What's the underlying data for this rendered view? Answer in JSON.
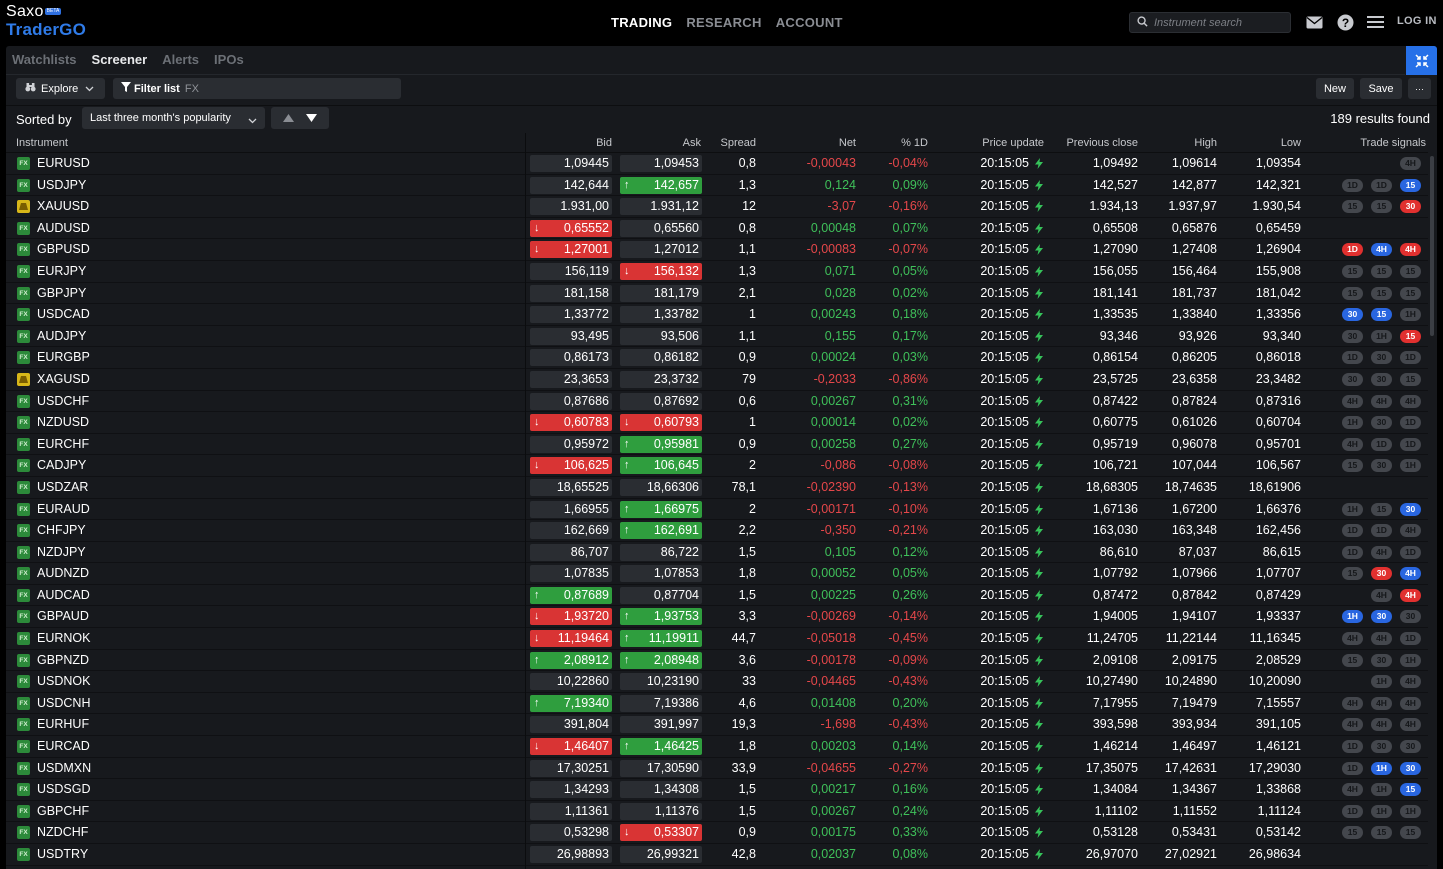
{
  "brand": {
    "name": "Saxo",
    "badge": "BETA",
    "product": "TraderGO"
  },
  "nav": {
    "items": [
      "TRADING",
      "RESEARCH",
      "ACCOUNT"
    ],
    "active": 0
  },
  "search": {
    "placeholder": "Instrument search"
  },
  "header": {
    "login": "LOG IN"
  },
  "subtabs": {
    "items": [
      "Watchlists",
      "Screener",
      "Alerts",
      "IPOs"
    ],
    "active": 1
  },
  "toolbar": {
    "explore": "Explore",
    "filter_label": "Filter list",
    "filter_value": "FX",
    "new": "New",
    "save": "Save",
    "more": "···"
  },
  "sort": {
    "label": "Sorted by",
    "value": "Last three month's popularity",
    "results": "189 results found"
  },
  "columns": {
    "instrument": "Instrument",
    "bid": "Bid",
    "ask": "Ask",
    "spread": "Spread",
    "net": "Net",
    "pct": "% 1D",
    "update": "Price update",
    "prev": "Previous close",
    "high": "High",
    "low": "Low",
    "signals": "Trade signals"
  },
  "colors": {
    "accent": "#2670e8",
    "up": "#2f9e3e",
    "down": "#d93434",
    "pos_text": "#3fc05a",
    "neg_text": "#e5474a"
  },
  "rows": [
    {
      "sym": "EURUSD",
      "icon": "fx",
      "bid": "1,09445",
      "bid_dir": "",
      "ask": "1,09453",
      "ask_dir": "",
      "spread": "0,8",
      "net": "-0,00043",
      "pct": "-0,04%",
      "time": "20:15:05",
      "prev": "1,09492",
      "high": "1,09614",
      "low": "1,09354",
      "signals": [
        [
          "4H",
          "g"
        ]
      ]
    },
    {
      "sym": "USDJPY",
      "icon": "fx",
      "bid": "142,644",
      "bid_dir": "",
      "ask": "142,657",
      "ask_dir": "up",
      "spread": "1,3",
      "net": "0,124",
      "pct": "0,09%",
      "time": "20:15:05",
      "prev": "142,527",
      "high": "142,877",
      "low": "142,321",
      "signals": [
        [
          "1D",
          "g"
        ],
        [
          "1D",
          "g"
        ],
        [
          "15",
          "b"
        ]
      ]
    },
    {
      "sym": "XAUUSD",
      "icon": "metal",
      "bid": "1.931,00",
      "bid_dir": "",
      "ask": "1.931,12",
      "ask_dir": "",
      "spread": "12",
      "net": "-3,07",
      "pct": "-0,16%",
      "time": "20:15:05",
      "prev": "1.934,13",
      "high": "1.937,97",
      "low": "1.930,54",
      "signals": [
        [
          "15",
          "g"
        ],
        [
          "15",
          "g"
        ],
        [
          "30",
          "r"
        ]
      ]
    },
    {
      "sym": "AUDUSD",
      "icon": "fx",
      "bid": "0,65552",
      "bid_dir": "down",
      "ask": "0,65560",
      "ask_dir": "",
      "spread": "0,8",
      "net": "0,00048",
      "pct": "0,07%",
      "time": "20:15:05",
      "prev": "0,65508",
      "high": "0,65876",
      "low": "0,65459",
      "signals": []
    },
    {
      "sym": "GBPUSD",
      "icon": "fx",
      "bid": "1,27001",
      "bid_dir": "down",
      "ask": "1,27012",
      "ask_dir": "",
      "spread": "1,1",
      "net": "-0,00083",
      "pct": "-0,07%",
      "time": "20:15:05",
      "prev": "1,27090",
      "high": "1,27408",
      "low": "1,26904",
      "signals": [
        [
          "1D",
          "r"
        ],
        [
          "4H",
          "b"
        ],
        [
          "4H",
          "r"
        ]
      ]
    },
    {
      "sym": "EURJPY",
      "icon": "fx",
      "bid": "156,119",
      "bid_dir": "",
      "ask": "156,132",
      "ask_dir": "down",
      "spread": "1,3",
      "net": "0,071",
      "pct": "0,05%",
      "time": "20:15:05",
      "prev": "156,055",
      "high": "156,464",
      "low": "155,908",
      "signals": [
        [
          "15",
          "g"
        ],
        [
          "15",
          "g"
        ],
        [
          "15",
          "g"
        ]
      ]
    },
    {
      "sym": "GBPJPY",
      "icon": "fx",
      "bid": "181,158",
      "bid_dir": "",
      "ask": "181,179",
      "ask_dir": "",
      "spread": "2,1",
      "net": "0,028",
      "pct": "0,02%",
      "time": "20:15:05",
      "prev": "181,141",
      "high": "181,737",
      "low": "181,042",
      "signals": [
        [
          "15",
          "g"
        ],
        [
          "15",
          "g"
        ],
        [
          "15",
          "g"
        ]
      ]
    },
    {
      "sym": "USDCAD",
      "icon": "fx",
      "bid": "1,33772",
      "bid_dir": "",
      "ask": "1,33782",
      "ask_dir": "",
      "spread": "1",
      "net": "0,00243",
      "pct": "0,18%",
      "time": "20:15:05",
      "prev": "1,33535",
      "high": "1,33840",
      "low": "1,33356",
      "signals": [
        [
          "30",
          "b"
        ],
        [
          "15",
          "b"
        ],
        [
          "1H",
          "g"
        ]
      ]
    },
    {
      "sym": "AUDJPY",
      "icon": "fx",
      "bid": "93,495",
      "bid_dir": "",
      "ask": "93,506",
      "ask_dir": "",
      "spread": "1,1",
      "net": "0,155",
      "pct": "0,17%",
      "time": "20:15:05",
      "prev": "93,346",
      "high": "93,926",
      "low": "93,340",
      "signals": [
        [
          "30",
          "g"
        ],
        [
          "1H",
          "g"
        ],
        [
          "15",
          "r"
        ]
      ]
    },
    {
      "sym": "EURGBP",
      "icon": "fx",
      "bid": "0,86173",
      "bid_dir": "",
      "ask": "0,86182",
      "ask_dir": "",
      "spread": "0,9",
      "net": "0,00024",
      "pct": "0,03%",
      "time": "20:15:05",
      "prev": "0,86154",
      "high": "0,86205",
      "low": "0,86018",
      "signals": [
        [
          "1D",
          "g"
        ],
        [
          "30",
          "g"
        ],
        [
          "1D",
          "g"
        ]
      ]
    },
    {
      "sym": "XAGUSD",
      "icon": "metal",
      "bid": "23,3653",
      "bid_dir": "",
      "ask": "23,3732",
      "ask_dir": "",
      "spread": "79",
      "net": "-0,2033",
      "pct": "-0,86%",
      "time": "20:15:05",
      "prev": "23,5725",
      "high": "23,6358",
      "low": "23,3482",
      "signals": [
        [
          "30",
          "g"
        ],
        [
          "30",
          "g"
        ],
        [
          "15",
          "g"
        ]
      ]
    },
    {
      "sym": "USDCHF",
      "icon": "fx",
      "bid": "0,87686",
      "bid_dir": "",
      "ask": "0,87692",
      "ask_dir": "",
      "spread": "0,6",
      "net": "0,00267",
      "pct": "0,31%",
      "time": "20:15:05",
      "prev": "0,87422",
      "high": "0,87824",
      "low": "0,87316",
      "signals": [
        [
          "4H",
          "g"
        ],
        [
          "4H",
          "g"
        ],
        [
          "4H",
          "g"
        ]
      ]
    },
    {
      "sym": "NZDUSD",
      "icon": "fx",
      "bid": "0,60783",
      "bid_dir": "down",
      "ask": "0,60793",
      "ask_dir": "down",
      "spread": "1",
      "net": "0,00014",
      "pct": "0,02%",
      "time": "20:15:05",
      "prev": "0,60775",
      "high": "0,61026",
      "low": "0,60704",
      "signals": [
        [
          "1H",
          "g"
        ],
        [
          "30",
          "g"
        ],
        [
          "1D",
          "g"
        ]
      ]
    },
    {
      "sym": "EURCHF",
      "icon": "fx",
      "bid": "0,95972",
      "bid_dir": "",
      "ask": "0,95981",
      "ask_dir": "up",
      "spread": "0,9",
      "net": "0,00258",
      "pct": "0,27%",
      "time": "20:15:05",
      "prev": "0,95719",
      "high": "0,96078",
      "low": "0,95701",
      "signals": [
        [
          "4H",
          "g"
        ],
        [
          "1D",
          "g"
        ],
        [
          "1D",
          "g"
        ]
      ]
    },
    {
      "sym": "CADJPY",
      "icon": "fx",
      "bid": "106,625",
      "bid_dir": "down",
      "ask": "106,645",
      "ask_dir": "up",
      "spread": "2",
      "net": "-0,086",
      "pct": "-0,08%",
      "time": "20:15:05",
      "prev": "106,721",
      "high": "107,044",
      "low": "106,567",
      "signals": [
        [
          "15",
          "g"
        ],
        [
          "30",
          "g"
        ],
        [
          "1H",
          "g"
        ]
      ]
    },
    {
      "sym": "USDZAR",
      "icon": "fx",
      "bid": "18,65525",
      "bid_dir": "",
      "ask": "18,66306",
      "ask_dir": "",
      "spread": "78,1",
      "net": "-0,02390",
      "pct": "-0,13%",
      "time": "20:15:05",
      "prev": "18,68305",
      "high": "18,74635",
      "low": "18,61906",
      "signals": []
    },
    {
      "sym": "EURAUD",
      "icon": "fx",
      "bid": "1,66955",
      "bid_dir": "",
      "ask": "1,66975",
      "ask_dir": "up",
      "spread": "2",
      "net": "-0,00171",
      "pct": "-0,10%",
      "time": "20:15:05",
      "prev": "1,67136",
      "high": "1,67200",
      "low": "1,66376",
      "signals": [
        [
          "1H",
          "g"
        ],
        [
          "15",
          "g"
        ],
        [
          "30",
          "b"
        ]
      ]
    },
    {
      "sym": "CHFJPY",
      "icon": "fx",
      "bid": "162,669",
      "bid_dir": "",
      "ask": "162,691",
      "ask_dir": "up",
      "spread": "2,2",
      "net": "-0,350",
      "pct": "-0,21%",
      "time": "20:15:05",
      "prev": "163,030",
      "high": "163,348",
      "low": "162,456",
      "signals": [
        [
          "1D",
          "g"
        ],
        [
          "1D",
          "g"
        ],
        [
          "4H",
          "g"
        ]
      ]
    },
    {
      "sym": "NZDJPY",
      "icon": "fx",
      "bid": "86,707",
      "bid_dir": "",
      "ask": "86,722",
      "ask_dir": "",
      "spread": "1,5",
      "net": "0,105",
      "pct": "0,12%",
      "time": "20:15:05",
      "prev": "86,610",
      "high": "87,037",
      "low": "86,615",
      "signals": [
        [
          "1D",
          "g"
        ],
        [
          "4H",
          "g"
        ],
        [
          "1D",
          "g"
        ]
      ]
    },
    {
      "sym": "AUDNZD",
      "icon": "fx",
      "bid": "1,07835",
      "bid_dir": "",
      "ask": "1,07853",
      "ask_dir": "",
      "spread": "1,8",
      "net": "0,00052",
      "pct": "0,05%",
      "time": "20:15:05",
      "prev": "1,07792",
      "high": "1,07966",
      "low": "1,07707",
      "signals": [
        [
          "15",
          "g"
        ],
        [
          "30",
          "r"
        ],
        [
          "4H",
          "b"
        ]
      ]
    },
    {
      "sym": "AUDCAD",
      "icon": "fx",
      "bid": "0,87689",
      "bid_dir": "up",
      "ask": "0,87704",
      "ask_dir": "",
      "spread": "1,5",
      "net": "0,00225",
      "pct": "0,26%",
      "time": "20:15:05",
      "prev": "0,87472",
      "high": "0,87842",
      "low": "0,87429",
      "signals": [
        [
          "4H",
          "g"
        ],
        [
          "4H",
          "r"
        ]
      ]
    },
    {
      "sym": "GBPAUD",
      "icon": "fx",
      "bid": "1,93720",
      "bid_dir": "down",
      "ask": "1,93753",
      "ask_dir": "up",
      "spread": "3,3",
      "net": "-0,00269",
      "pct": "-0,14%",
      "time": "20:15:05",
      "prev": "1,94005",
      "high": "1,94107",
      "low": "1,93337",
      "signals": [
        [
          "1H",
          "b"
        ],
        [
          "30",
          "b"
        ],
        [
          "30",
          "g"
        ]
      ]
    },
    {
      "sym": "EURNOK",
      "icon": "fx",
      "bid": "11,19464",
      "bid_dir": "down",
      "ask": "11,19911",
      "ask_dir": "up",
      "spread": "44,7",
      "net": "-0,05018",
      "pct": "-0,45%",
      "time": "20:15:05",
      "prev": "11,24705",
      "high": "11,22144",
      "low": "11,16345",
      "signals": [
        [
          "4H",
          "g"
        ],
        [
          "4H",
          "g"
        ],
        [
          "1D",
          "g"
        ]
      ]
    },
    {
      "sym": "GBPNZD",
      "icon": "fx",
      "bid": "2,08912",
      "bid_dir": "up",
      "ask": "2,08948",
      "ask_dir": "up",
      "spread": "3,6",
      "net": "-0,00178",
      "pct": "-0,09%",
      "time": "20:15:05",
      "prev": "2,09108",
      "high": "2,09175",
      "low": "2,08529",
      "signals": [
        [
          "15",
          "g"
        ],
        [
          "30",
          "g"
        ],
        [
          "1H",
          "g"
        ]
      ]
    },
    {
      "sym": "USDNOK",
      "icon": "fx",
      "bid": "10,22860",
      "bid_dir": "",
      "ask": "10,23190",
      "ask_dir": "",
      "spread": "33",
      "net": "-0,04465",
      "pct": "-0,43%",
      "time": "20:15:05",
      "prev": "10,27490",
      "high": "10,24890",
      "low": "10,20090",
      "signals": [
        [
          "1H",
          "g"
        ],
        [
          "4H",
          "g"
        ]
      ]
    },
    {
      "sym": "USDCNH",
      "icon": "fx",
      "bid": "7,19340",
      "bid_dir": "up",
      "ask": "7,19386",
      "ask_dir": "",
      "spread": "4,6",
      "net": "0,01408",
      "pct": "0,20%",
      "time": "20:15:05",
      "prev": "7,17955",
      "high": "7,19479",
      "low": "7,15557",
      "signals": [
        [
          "4H",
          "g"
        ],
        [
          "4H",
          "g"
        ],
        [
          "4H",
          "g"
        ]
      ]
    },
    {
      "sym": "EURHUF",
      "icon": "fx",
      "bid": "391,804",
      "bid_dir": "",
      "ask": "391,997",
      "ask_dir": "",
      "spread": "19,3",
      "net": "-1,698",
      "pct": "-0,43%",
      "time": "20:15:05",
      "prev": "393,598",
      "high": "393,934",
      "low": "391,105",
      "signals": [
        [
          "4H",
          "g"
        ],
        [
          "4H",
          "g"
        ],
        [
          "4H",
          "g"
        ]
      ]
    },
    {
      "sym": "EURCAD",
      "icon": "fx",
      "bid": "1,46407",
      "bid_dir": "down",
      "ask": "1,46425",
      "ask_dir": "up",
      "spread": "1,8",
      "net": "0,00203",
      "pct": "0,14%",
      "time": "20:15:05",
      "prev": "1,46214",
      "high": "1,46497",
      "low": "1,46121",
      "signals": [
        [
          "1D",
          "g"
        ],
        [
          "30",
          "g"
        ],
        [
          "30",
          "g"
        ]
      ]
    },
    {
      "sym": "USDMXN",
      "icon": "fx",
      "bid": "17,30251",
      "bid_dir": "",
      "ask": "17,30590",
      "ask_dir": "",
      "spread": "33,9",
      "net": "-0,04655",
      "pct": "-0,27%",
      "time": "20:15:05",
      "prev": "17,35075",
      "high": "17,42631",
      "low": "17,29030",
      "signals": [
        [
          "1D",
          "g"
        ],
        [
          "1H",
          "b"
        ],
        [
          "30",
          "b"
        ]
      ]
    },
    {
      "sym": "USDSGD",
      "icon": "fx",
      "bid": "1,34293",
      "bid_dir": "",
      "ask": "1,34308",
      "ask_dir": "",
      "spread": "1,5",
      "net": "0,00217",
      "pct": "0,16%",
      "time": "20:15:05",
      "prev": "1,34084",
      "high": "1,34367",
      "low": "1,33868",
      "signals": [
        [
          "4H",
          "g"
        ],
        [
          "1H",
          "g"
        ],
        [
          "15",
          "b"
        ]
      ]
    },
    {
      "sym": "GBPCHF",
      "icon": "fx",
      "bid": "1,11361",
      "bid_dir": "",
      "ask": "1,11376",
      "ask_dir": "",
      "spread": "1,5",
      "net": "0,00267",
      "pct": "0,24%",
      "time": "20:15:05",
      "prev": "1,11102",
      "high": "1,11552",
      "low": "1,11124",
      "signals": [
        [
          "1D",
          "g"
        ],
        [
          "1H",
          "g"
        ],
        [
          "1H",
          "g"
        ]
      ]
    },
    {
      "sym": "NZDCHF",
      "icon": "fx",
      "bid": "0,53298",
      "bid_dir": "",
      "ask": "0,53307",
      "ask_dir": "down",
      "spread": "0,9",
      "net": "0,00175",
      "pct": "0,33%",
      "time": "20:15:05",
      "prev": "0,53128",
      "high": "0,53431",
      "low": "0,53142",
      "signals": [
        [
          "15",
          "g"
        ],
        [
          "15",
          "g"
        ],
        [
          "15",
          "g"
        ]
      ]
    },
    {
      "sym": "USDTRY",
      "icon": "fx",
      "bid": "26,98893",
      "bid_dir": "",
      "ask": "26,99321",
      "ask_dir": "",
      "spread": "42,8",
      "net": "0,02037",
      "pct": "0,08%",
      "time": "20:15:05",
      "prev": "26,97070",
      "high": "27,02921",
      "low": "26,98634",
      "signals": []
    }
  ]
}
